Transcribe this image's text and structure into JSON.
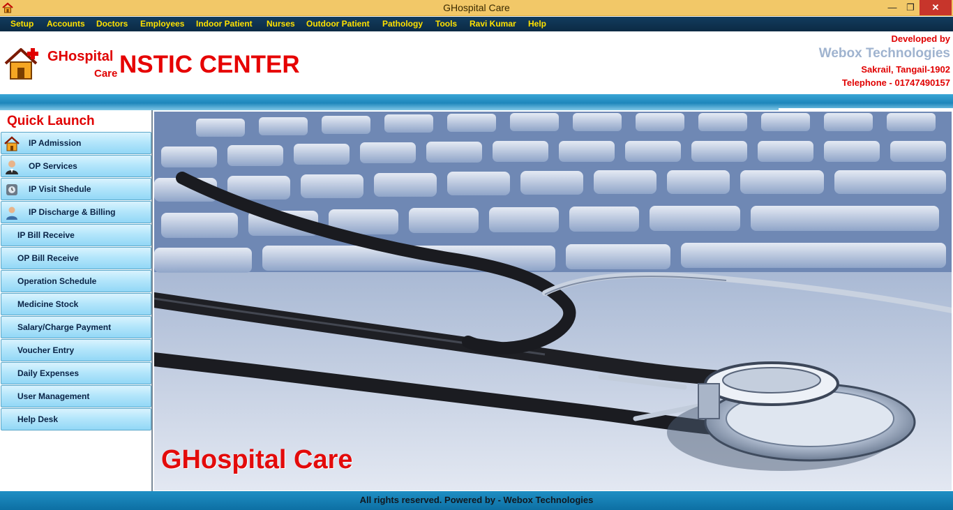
{
  "window": {
    "title": "GHospital Care",
    "controls": {
      "minimize": "—",
      "maximize": "❐",
      "close": "✕"
    }
  },
  "menu": [
    "Setup",
    "Accounts",
    "Doctors",
    "Employees",
    "Indoor Patient",
    "Nurses",
    "Outdoor Patient",
    "Pathology",
    "Tools",
    "Ravi Kumar",
    "Help"
  ],
  "header": {
    "logo_name": "GHospital",
    "logo_sub": "Care",
    "center_name": "NSTIC CENTER",
    "developed_by": "Developed by",
    "company": "Webox Technologies",
    "address": "Sakrail, Tangail-1902",
    "telephone": "Telephone - 01747490157"
  },
  "sidebar": {
    "title": "Quick Launch",
    "items": [
      {
        "label": "IP Admission",
        "icon": "house-icon"
      },
      {
        "label": "OP Services",
        "icon": "doctor-icon"
      },
      {
        "label": "IP Visit Shedule",
        "icon": "schedule-icon"
      },
      {
        "label": "IP Discharge & Billing",
        "icon": "patient-icon"
      },
      {
        "label": "IP Bill Receive",
        "icon": ""
      },
      {
        "label": "OP Bill Receive",
        "icon": ""
      },
      {
        "label": "Operation Schedule",
        "icon": ""
      },
      {
        "label": "Medicine Stock",
        "icon": ""
      },
      {
        "label": "Salary/Charge Payment",
        "icon": ""
      },
      {
        "label": "Voucher Entry",
        "icon": ""
      },
      {
        "label": "Daily Expenses",
        "icon": ""
      },
      {
        "label": "User Management",
        "icon": ""
      },
      {
        "label": "Help Desk",
        "icon": ""
      }
    ]
  },
  "main": {
    "banner_text": "GHospital Care"
  },
  "footer": {
    "text": "All rights reserved. Powered by - Webox Technologies"
  },
  "colors": {
    "titlebar": "#f2c868",
    "menubar": "#0b2a44",
    "menu_text": "#ffe100",
    "brand_red": "#e00000",
    "company_gray_blue": "#9fb3cf",
    "quick_button": "#b4e6fb",
    "footer": "#1f8fc4"
  }
}
